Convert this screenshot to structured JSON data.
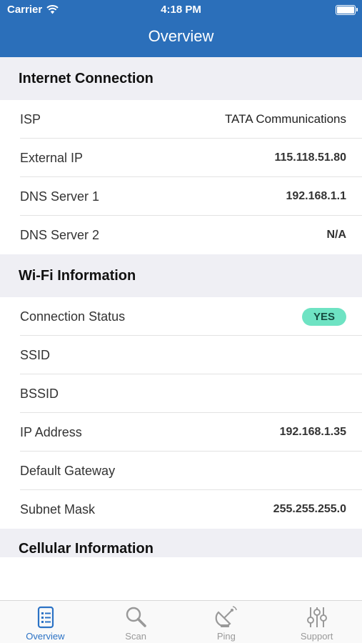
{
  "status_bar": {
    "carrier": "Carrier",
    "time": "4:18 PM"
  },
  "nav": {
    "title": "Overview"
  },
  "internet": {
    "header": "Internet Connection",
    "rows": [
      {
        "label": "ISP",
        "value": "TATA Communications"
      },
      {
        "label": "External IP",
        "value": "115.118.51.80"
      },
      {
        "label": "DNS Server 1",
        "value": "192.168.1.1"
      },
      {
        "label": "DNS Server 2",
        "value": "N/A"
      }
    ]
  },
  "wifi": {
    "header": "Wi-Fi Information",
    "rows": [
      {
        "label": "Connection Status",
        "value": "YES"
      },
      {
        "label": "SSID",
        "value": ""
      },
      {
        "label": "BSSID",
        "value": ""
      },
      {
        "label": "IP Address",
        "value": "192.168.1.35"
      },
      {
        "label": "Default Gateway",
        "value": ""
      },
      {
        "label": "Subnet Mask",
        "value": "255.255.255.0"
      }
    ]
  },
  "cellular": {
    "header": "Cellular Information"
  },
  "tabs": [
    {
      "label": "Overview",
      "icon": "document-list-icon",
      "active": true
    },
    {
      "label": "Scan",
      "icon": "magnifier-icon",
      "active": false
    },
    {
      "label": "Ping",
      "icon": "satellite-dish-icon",
      "active": false
    },
    {
      "label": "Support",
      "icon": "sliders-icon",
      "active": false
    }
  ],
  "colors": {
    "nav_bar": "#2b6fba",
    "accent": "#2b72c5",
    "badge": "#6ee3c3",
    "section_bg": "#efeff4"
  }
}
